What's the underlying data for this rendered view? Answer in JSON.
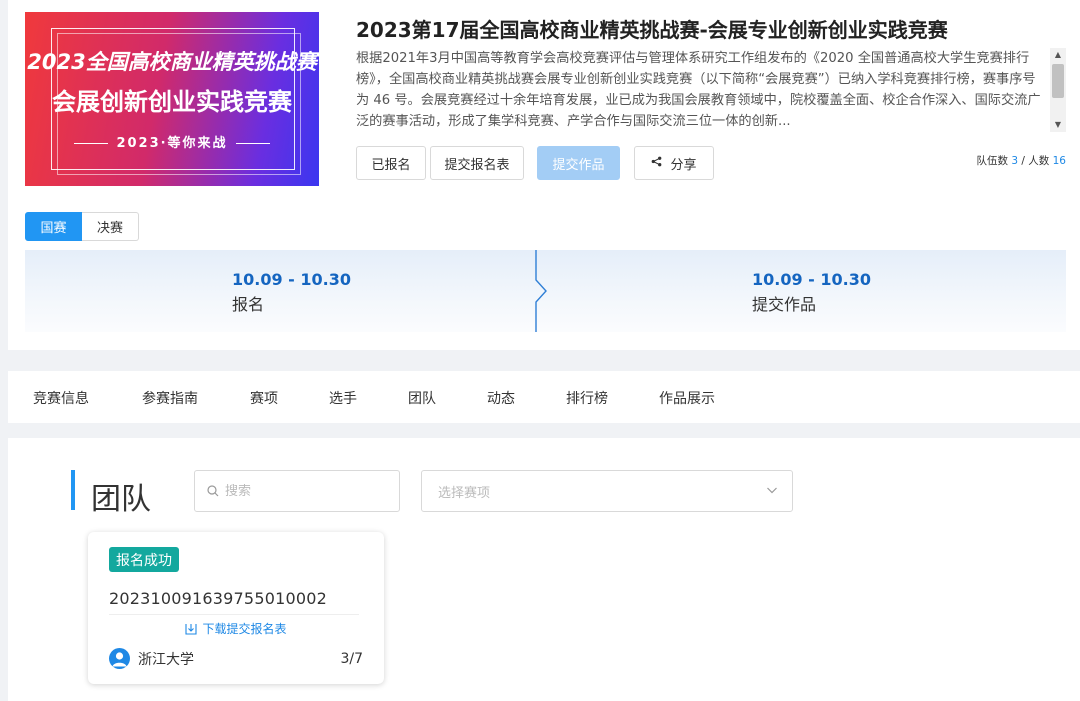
{
  "banner": {
    "line1": "2023全国高校商业精英挑战赛",
    "line2": "会展创新创业实践竞赛",
    "line3": "2023·等你来战"
  },
  "competition": {
    "title": "2023第17届全国高校商业精英挑战赛-会展专业创新创业实践竞赛",
    "description": "根据2021年3月中国高等教育学会高校竞赛评估与管理体系研究工作组发布的《2020 全国普通高校大学生竞赛排行榜》，全国高校商业精英挑战赛会展专业创新创业实践竞赛（以下简称“会展竞赛”）已纳入学科竞赛排行榜，赛事序号为 46 号。会展竞赛经过十余年培育发展，业已成为我国会展教育领域中，院校覆盖全面、校企合作深入、国际交流广泛的赛事活动，形成了集学科竞赛、产学合作与国际交流三位一体的创新..."
  },
  "actions": {
    "registered": "已报名",
    "submit_form": "提交报名表",
    "submit_work": "提交作品",
    "share": "分享"
  },
  "stats": {
    "teams_label": "队伍数",
    "teams_value": "3",
    "separator": "/",
    "people_label": "人数",
    "people_value": "16"
  },
  "stage_tabs": [
    "国赛",
    "决赛"
  ],
  "timeline": [
    {
      "date": "10.09 - 10.30",
      "label": "报名"
    },
    {
      "date": "10.09 - 10.30",
      "label": "提交作品"
    }
  ],
  "nav": [
    "竞赛信息",
    "参赛指南",
    "赛项",
    "选手",
    "团队",
    "动态",
    "排行榜",
    "作品展示"
  ],
  "team_section": {
    "title": "团队",
    "search_placeholder": "搜索",
    "select_placeholder": "选择赛项"
  },
  "team_card": {
    "status": "报名成功",
    "team_id": "20231009163975501000 2",
    "download": "下载提交报名表",
    "school": "浙江大学",
    "members": "3/7"
  },
  "colors": {
    "primary": "#2196f3",
    "link": "#1e88e5",
    "success_badge": "#13a89e",
    "disabled_button": "#a3cdf5"
  }
}
